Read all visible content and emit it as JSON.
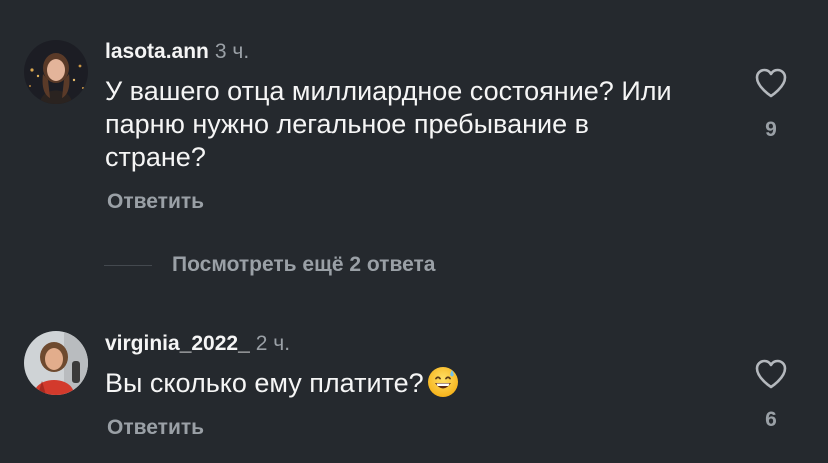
{
  "comments": [
    {
      "username": "lasota.ann",
      "time": "3 ч.",
      "text_lines": [
        "У вашего отца миллиардное состояние? Или",
        "парню нужно легальное пребывание в",
        "стране?"
      ],
      "reply_label": "Ответить",
      "likes": "9",
      "like_icon": "heart-outline-icon",
      "avatar": "user-avatar-photo"
    },
    {
      "username": "virginia_2022_",
      "time": "2 ч.",
      "text": "Вы сколько ему платите?",
      "emoji": "grinning-face-with-sweat-emoji",
      "reply_label": "Ответить",
      "likes": "6",
      "like_icon": "heart-outline-icon",
      "avatar": "user-avatar-photo"
    }
  ],
  "view_more": {
    "label": "Посмотреть ещё 2 ответа"
  },
  "colors": {
    "background": "#25292e",
    "primary_text": "#f5f5f5",
    "secondary_text": "#9aa0a6",
    "divider": "#44494f"
  }
}
